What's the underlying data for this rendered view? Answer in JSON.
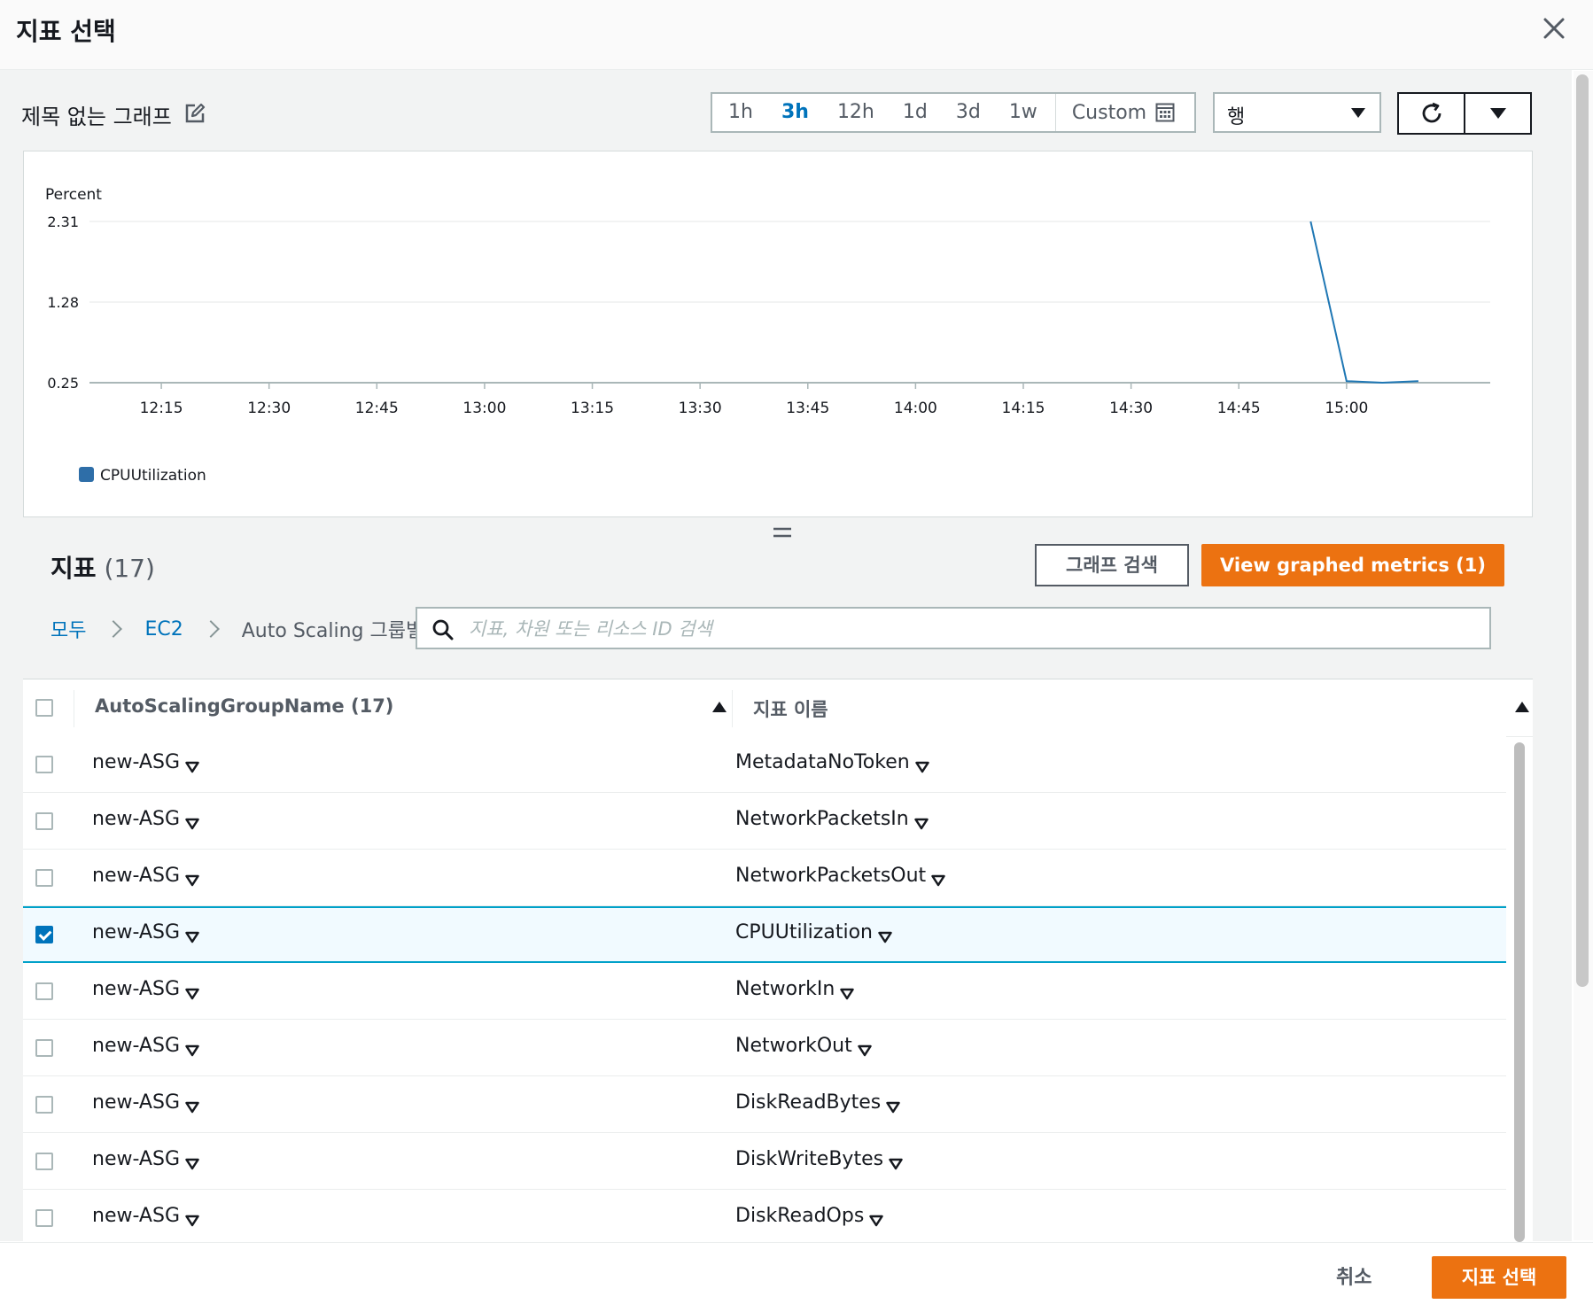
{
  "modal": {
    "title": "지표 선택"
  },
  "graph": {
    "title": "제목 없는 그래프"
  },
  "time_range": {
    "options": [
      "1h",
      "3h",
      "12h",
      "1d",
      "3d",
      "1w"
    ],
    "active": "3h",
    "custom_label": "Custom"
  },
  "view_select": {
    "value": "행"
  },
  "chart_data": {
    "type": "line",
    "ylabel": "Percent",
    "y_ticks": [
      "2.31",
      "1.28",
      "0.25"
    ],
    "ylim": [
      0.25,
      2.31
    ],
    "x_ticks": [
      "12:15",
      "12:30",
      "12:45",
      "13:00",
      "13:15",
      "13:30",
      "13:45",
      "14:00",
      "14:15",
      "14:30",
      "14:45",
      "15:00"
    ],
    "series": [
      {
        "name": "CPUUtilization",
        "color": "#1f77b4",
        "points": [
          [
            "14:55",
            2.31
          ],
          [
            "15:00",
            0.27
          ],
          [
            "15:05",
            0.25
          ],
          [
            "15:10",
            0.27
          ]
        ]
      }
    ],
    "legend_position": "bottom-left",
    "grid": true
  },
  "metrics": {
    "title": "지표",
    "count": "(17)",
    "search_graph_label": "그래프 검색",
    "view_graphed_label": "View graphed metrics (1)",
    "breadcrumb": [
      {
        "label": "모두"
      },
      {
        "label": "EC2"
      },
      {
        "label": "Auto Scaling 그룹별"
      }
    ],
    "search_placeholder": "지표, 차원 또는 리소스 ID 검색",
    "table": {
      "col1_header": "AutoScalingGroupName",
      "col1_count": "(17)",
      "col2_header": "지표 이름",
      "rows": [
        {
          "asg": "new-ASG",
          "metric": "MetadataNoToken",
          "checked": false
        },
        {
          "asg": "new-ASG",
          "metric": "NetworkPacketsIn",
          "checked": false
        },
        {
          "asg": "new-ASG",
          "metric": "NetworkPacketsOut",
          "checked": false
        },
        {
          "asg": "new-ASG",
          "metric": "CPUUtilization",
          "checked": true
        },
        {
          "asg": "new-ASG",
          "metric": "NetworkIn",
          "checked": false
        },
        {
          "asg": "new-ASG",
          "metric": "NetworkOut",
          "checked": false
        },
        {
          "asg": "new-ASG",
          "metric": "DiskReadBytes",
          "checked": false
        },
        {
          "asg": "new-ASG",
          "metric": "DiskWriteBytes",
          "checked": false
        },
        {
          "asg": "new-ASG",
          "metric": "DiskReadOps",
          "checked": false
        }
      ]
    }
  },
  "footer": {
    "cancel_label": "취소",
    "select_label": "지표 선택"
  },
  "colors": {
    "accent": "#ec7211",
    "link": "#0073bb",
    "selected_border": "#00a1c9"
  }
}
